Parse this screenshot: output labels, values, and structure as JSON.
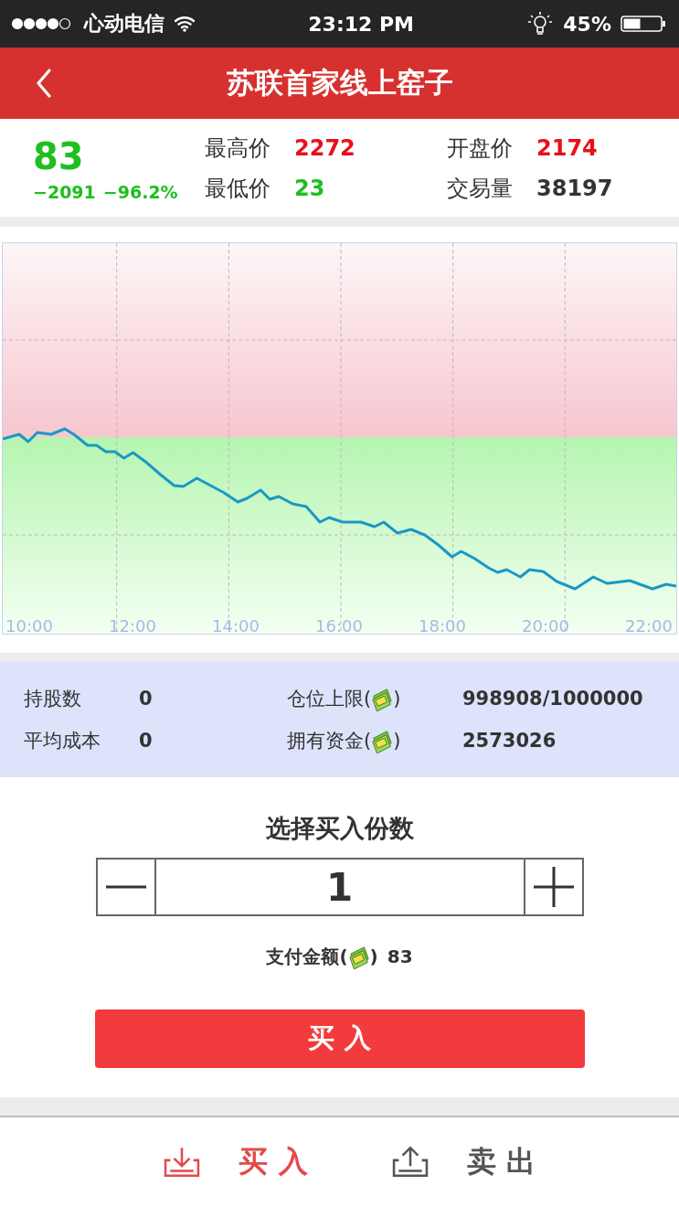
{
  "status_bar": {
    "carrier": "心动电信",
    "time": "23:12 PM",
    "battery": "45%"
  },
  "header": {
    "title": "苏联首家线上窑子"
  },
  "quote": {
    "price": "83",
    "change": "−2091",
    "change_pct": "−96.2%",
    "stats": [
      {
        "label": "最高价",
        "value": "2272",
        "color": "#e8101b"
      },
      {
        "label": "开盘价",
        "value": "2174",
        "color": "#e8101b"
      },
      {
        "label": "最低价",
        "value": "23",
        "color": "#1fbf1f"
      },
      {
        "label": "交易量",
        "value": "38197",
        "color": "#333333"
      }
    ]
  },
  "chart": {
    "time_labels": [
      "10:00",
      "12:00",
      "14:00",
      "16:00",
      "18:00",
      "20:00",
      "22:00"
    ]
  },
  "holdings": [
    {
      "label": "持股数",
      "value": "0",
      "kind": "plain"
    },
    {
      "label": "仓位上限(",
      "label_end": ")",
      "value": "998908/1000000",
      "kind": "money"
    },
    {
      "label": "平均成本",
      "value": "0",
      "kind": "plain"
    },
    {
      "label": "拥有资金(",
      "label_end": ")",
      "value": "2573026",
      "kind": "money"
    }
  ],
  "order": {
    "title": "选择买入份数",
    "quantity": "1",
    "pay_label": "支付金额(",
    "pay_label_end": ")",
    "pay_amount": "83",
    "submit": "买 入"
  },
  "bottom_tabs": [
    {
      "label": "买 入",
      "selected": true
    },
    {
      "label": "卖 出",
      "selected": false
    }
  ]
}
